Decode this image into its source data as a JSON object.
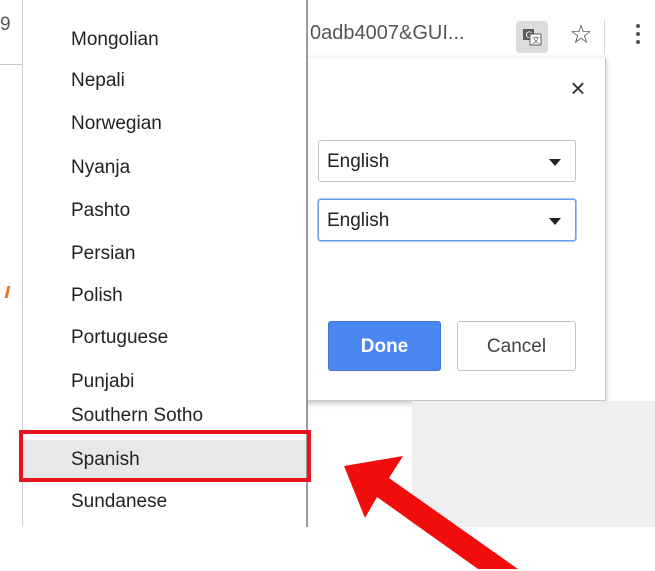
{
  "browser": {
    "url_left_fragment": "9",
    "url_text": "0adb4007&GUI...",
    "translate_icon": "translate-icon",
    "star_icon": "star-icon",
    "menu_icon": "more-vert-icon"
  },
  "dialog": {
    "close_label": "×",
    "from_language": "English",
    "to_language": "English",
    "done_label": "Done",
    "cancel_label": "Cancel"
  },
  "dropdown": {
    "options": [
      "Mongolian",
      "Nepali",
      "Norwegian",
      "Nyanja",
      "Pashto",
      "Persian",
      "Polish",
      "Portuguese",
      "Punjabi",
      "Southern Sotho",
      "Spanish",
      "Sundanese"
    ],
    "selected": "Spanish"
  },
  "annotation": {
    "highlight_color": "#e8141d",
    "arrow_color": "#f20d0d"
  },
  "colors": {
    "done_button": "#4a87f0"
  }
}
